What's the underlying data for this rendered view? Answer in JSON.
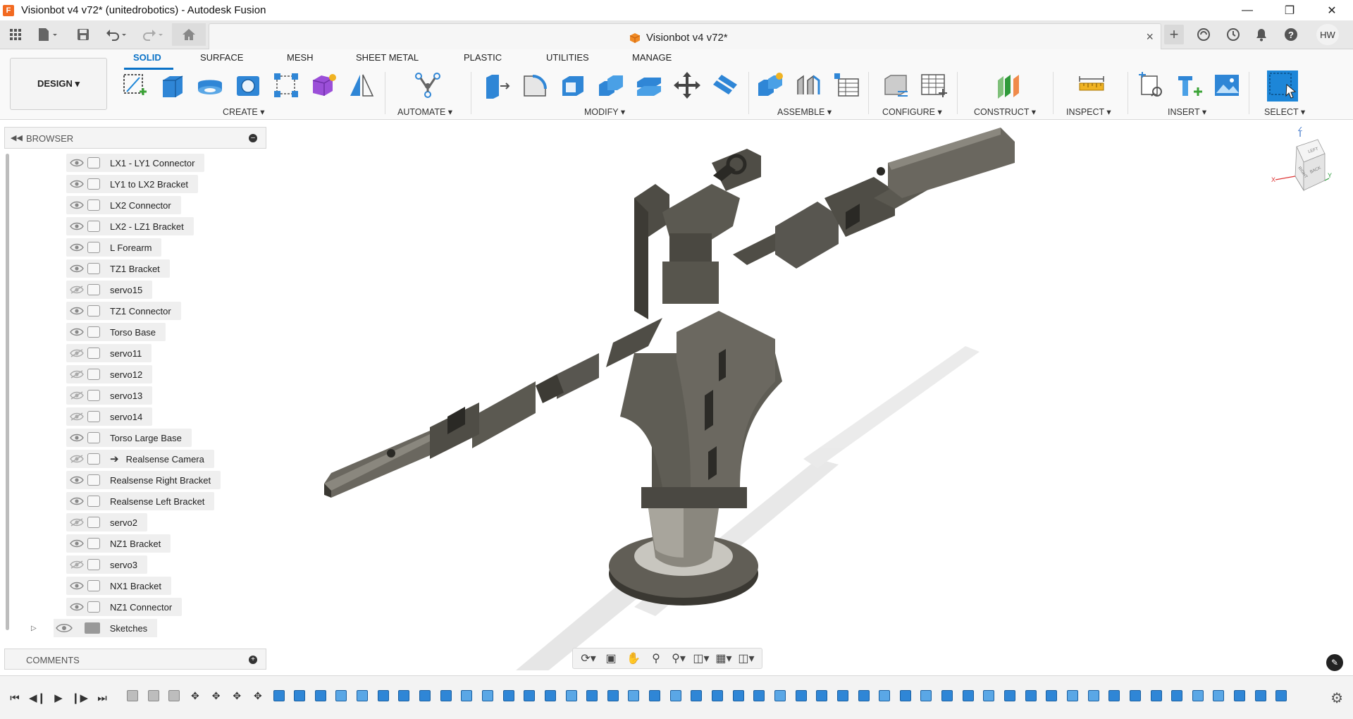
{
  "window": {
    "title": "Visionbot v4 v72* (unitedrobotics) - Autodesk Fusion",
    "app_icon": "F",
    "buttons": [
      "minimize-icon",
      "restore-icon",
      "close-icon"
    ]
  },
  "topbar": {
    "quick_access": [
      "app-grid-icon",
      "file-icon",
      "save-icon",
      "undo-icon",
      "redo-icon",
      "home-icon"
    ],
    "doc_tab": {
      "title": "Visionbot v4 v72*",
      "close": "×"
    },
    "right_icons": [
      "add-tab-icon",
      "extensions-icon",
      "job-status-icon",
      "notifications-icon",
      "help-icon"
    ],
    "user_initials": "HW"
  },
  "ribbon": {
    "workspace": "DESIGN ▾",
    "tabs": [
      "SOLID",
      "SURFACE",
      "MESH",
      "SHEET METAL",
      "PLASTIC",
      "UTILITIES",
      "MANAGE"
    ],
    "active_tab": "SOLID",
    "groups": [
      {
        "label": "CREATE ▾",
        "icons": [
          "create-sketch-icon",
          "extrude-icon",
          "revolve-icon",
          "hole-icon",
          "rectangular-pattern-icon",
          "form-icon",
          "mirror-icon"
        ]
      },
      {
        "label": "AUTOMATE ▾",
        "icons": [
          "automate-icon"
        ]
      },
      {
        "label": "MODIFY ▾",
        "icons": [
          "press-pull-icon",
          "fillet-icon",
          "shell-icon",
          "combine-icon",
          "offset-face-icon",
          "move-icon",
          "split-body-icon"
        ]
      },
      {
        "label": "ASSEMBLE ▾",
        "icons": [
          "new-component-icon",
          "joint-icon",
          "joint-table-icon"
        ]
      },
      {
        "label": "CONFIGURE ▾",
        "icons": [
          "configure-icon",
          "configuration-table-icon"
        ]
      },
      {
        "label": "CONSTRUCT ▾",
        "icons": [
          "offset-plane-icon"
        ]
      },
      {
        "label": "INSPECT ▾",
        "icons": [
          "measure-icon"
        ]
      },
      {
        "label": "INSERT ▾",
        "icons": [
          "insert-derive-icon",
          "insert-mcmaster-icon",
          "insert-canvas-icon"
        ]
      },
      {
        "label": "SELECT ▾",
        "icons": [
          "select-icon"
        ]
      }
    ]
  },
  "browser": {
    "title": "BROWSER",
    "items": [
      {
        "name": "LX1 - LY1 Connector",
        "visible": true,
        "linked": false
      },
      {
        "name": "LY1 to LX2 Bracket",
        "visible": true,
        "linked": false
      },
      {
        "name": "LX2 Connector",
        "visible": true,
        "linked": false
      },
      {
        "name": "LX2 - LZ1 Bracket",
        "visible": true,
        "linked": false
      },
      {
        "name": "L Forearm",
        "visible": true,
        "linked": false
      },
      {
        "name": "TZ1 Bracket",
        "visible": true,
        "linked": false
      },
      {
        "name": "servo15",
        "visible": false,
        "linked": false
      },
      {
        "name": "TZ1 Connector",
        "visible": true,
        "linked": false
      },
      {
        "name": "Torso Base",
        "visible": true,
        "linked": false
      },
      {
        "name": "servo11",
        "visible": false,
        "linked": false
      },
      {
        "name": "servo12",
        "visible": false,
        "linked": false
      },
      {
        "name": "servo13",
        "visible": false,
        "linked": false
      },
      {
        "name": "servo14",
        "visible": false,
        "linked": false
      },
      {
        "name": "Torso Large Base",
        "visible": true,
        "linked": false
      },
      {
        "name": "Realsense Camera",
        "visible": false,
        "linked": true
      },
      {
        "name": "Realsense Right Bracket",
        "visible": true,
        "linked": false
      },
      {
        "name": "Realsense Left Bracket",
        "visible": true,
        "linked": false
      },
      {
        "name": "servo2",
        "visible": false,
        "linked": false
      },
      {
        "name": "NZ1 Bracket",
        "visible": true,
        "linked": false
      },
      {
        "name": "servo3",
        "visible": false,
        "linked": false
      },
      {
        "name": "NX1 Bracket",
        "visible": true,
        "linked": false
      },
      {
        "name": "NZ1 Connector",
        "visible": true,
        "linked": false
      }
    ],
    "sketches_label": "Sketches"
  },
  "comments": {
    "title": "COMMENTS"
  },
  "viewcube": {
    "z": "Z",
    "x": "X",
    "y": "Y",
    "face_top": "LEFT",
    "face_left": "RIGHT",
    "face_right": "BACK"
  },
  "navbar": {
    "icons": [
      "orbit-icon",
      "look-at-icon",
      "pan-icon",
      "zoom-icon",
      "fit-icon",
      "display-settings-icon",
      "grid-icon",
      "viewports-icon"
    ]
  },
  "timeline": {
    "controls": [
      "go-to-start-icon",
      "step-back-icon",
      "play-icon",
      "step-forward-icon",
      "go-to-end-icon"
    ],
    "feature_count": 56
  },
  "colors": {
    "accent": "#0a72c7",
    "model": "#5a5850",
    "model_dark": "#3e3c36",
    "shadow": "#d6d6d6"
  }
}
